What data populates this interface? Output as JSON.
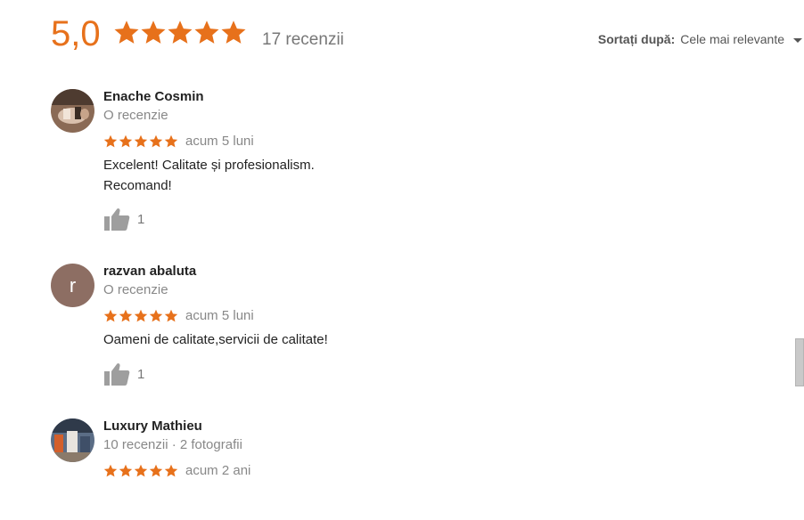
{
  "summary": {
    "score": "5,0",
    "stars": 5,
    "count_text": "17 recenzii",
    "star_color": "#e7711b"
  },
  "sort": {
    "label": "Sortați după:",
    "value": "Cele mai relevante"
  },
  "reviews": [
    {
      "name": "Enache Cosmin",
      "meta": "O recenzie",
      "stars": 5,
      "time": "acum 5 luni",
      "text_lines": [
        "Excelent! Calitate și profesionalism.",
        "Recomand!"
      ],
      "likes": "1",
      "avatar": "photo"
    },
    {
      "name": "razvan abaluta",
      "meta": "O recenzie",
      "stars": 5,
      "time": "acum 5 luni",
      "text_lines": [
        "Oameni de calitate,servicii de calitate!"
      ],
      "likes": "1",
      "avatar": "r"
    },
    {
      "name": "Luxury Mathieu",
      "meta": "10 recenzii · 2 fotografii",
      "stars": 5,
      "time": "acum 2 ani",
      "text_lines": [],
      "avatar": "photo"
    }
  ]
}
